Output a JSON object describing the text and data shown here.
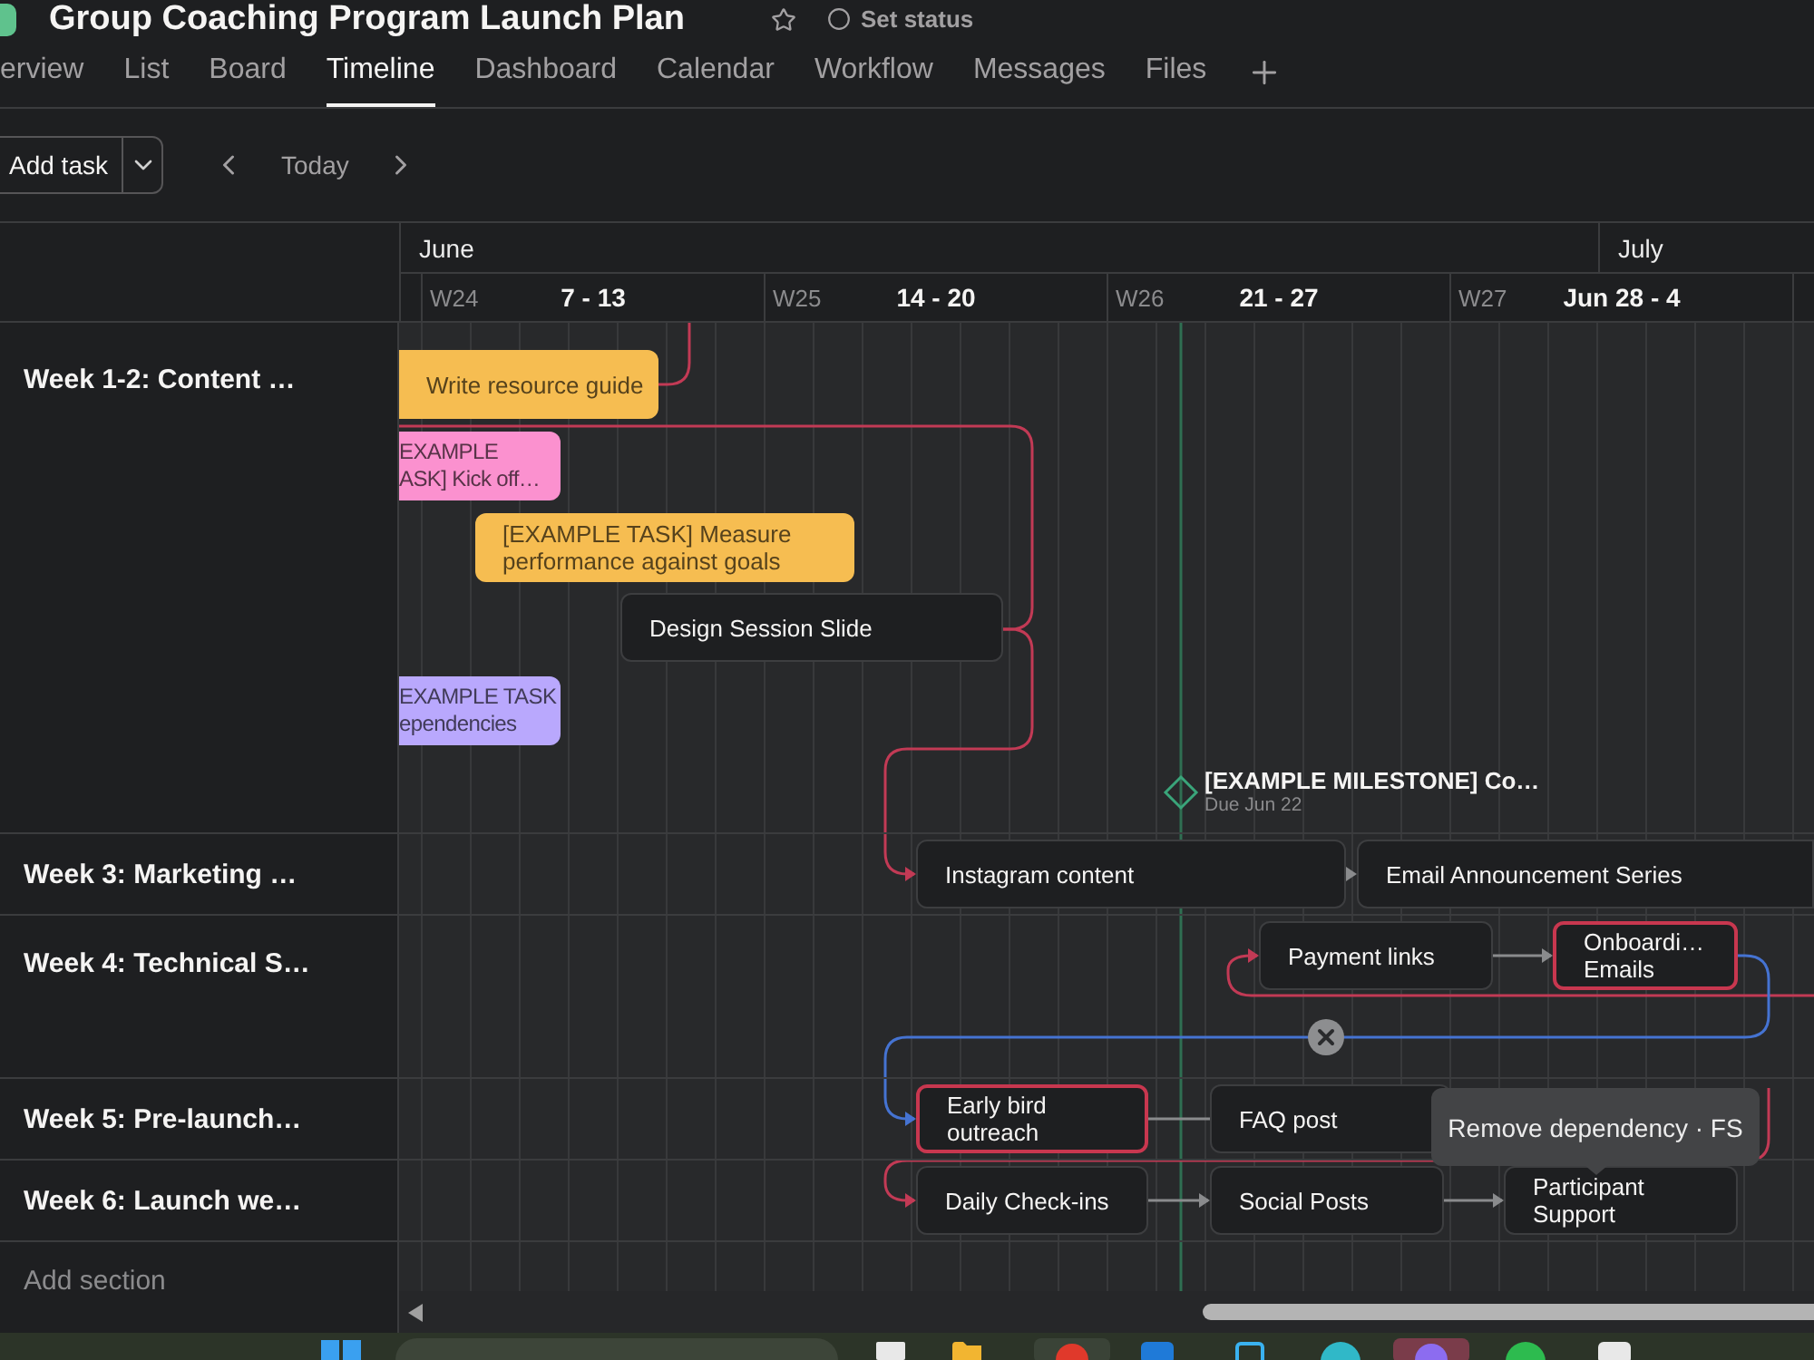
{
  "project": {
    "title": "Group Coaching Program Launch Plan",
    "status": "Set status"
  },
  "tabs": [
    {
      "label": "erview",
      "selected": false
    },
    {
      "label": "List",
      "selected": false
    },
    {
      "label": "Board",
      "selected": false
    },
    {
      "label": "Timeline",
      "selected": true
    },
    {
      "label": "Dashboard",
      "selected": false
    },
    {
      "label": "Calendar",
      "selected": false
    },
    {
      "label": "Workflow",
      "selected": false
    },
    {
      "label": "Messages",
      "selected": false
    },
    {
      "label": "Files",
      "selected": false
    }
  ],
  "toolbar": {
    "add_task": "Add task",
    "today": "Today"
  },
  "timeline": {
    "months": [
      "June",
      "July"
    ],
    "weeks": [
      {
        "number": "W24",
        "range": "7 - 13"
      },
      {
        "number": "W25",
        "range": "14 - 20"
      },
      {
        "number": "W26",
        "range": "21 - 27"
      },
      {
        "number": "W27",
        "range": "Jun 28 - 4"
      }
    ]
  },
  "sections": [
    {
      "name": "Week 1-2: Content …",
      "tasks": [
        {
          "name": "Write resource guide",
          "color": "#f6bd51",
          "highlighted": false
        },
        {
          "name": "EXAMPLE\nASK] Kick off…",
          "color": "#fb91cf",
          "highlighted": false
        },
        {
          "name": "[EXAMPLE TASK] Measure performance against goals",
          "color": "#f6bd51",
          "highlighted": false
        },
        {
          "name": "Design Session Slide",
          "color": "#1e1f21",
          "highlighted": false
        },
        {
          "name": "EXAMPLE TASK\nependencies",
          "color": "#b9a8fd",
          "highlighted": false
        }
      ],
      "milestones": [
        {
          "name": "[EXAMPLE MILESTONE] Co…",
          "due": "Due Jun 22"
        }
      ]
    },
    {
      "name": "Week 3: Marketing …",
      "tasks": [
        {
          "name": "Instagram content",
          "color": "#1e1f21",
          "highlighted": false
        },
        {
          "name": "Email Announcement Series",
          "color": "#1e1f21",
          "highlighted": false
        }
      ]
    },
    {
      "name": "Week 4: Technical S…",
      "tasks": [
        {
          "name": "Payment links",
          "color": "#1e1f21",
          "highlighted": false
        },
        {
          "name": "Onboardi… Emails",
          "color": "#1e1f21",
          "highlighted": true
        }
      ]
    },
    {
      "name": "Week 5: Pre-launch…",
      "tasks": [
        {
          "name": "Early bird outreach",
          "color": "#1e1f21",
          "highlighted": true
        },
        {
          "name": "FAQ post",
          "color": "#1e1f21",
          "highlighted": false
        }
      ]
    },
    {
      "name": "Week 6: Launch we…",
      "tasks": [
        {
          "name": "Daily Check-ins",
          "color": "#1e1f21",
          "highlighted": false
        },
        {
          "name": "Social Posts",
          "color": "#1e1f21",
          "highlighted": false
        },
        {
          "name": "Participant Support",
          "color": "#1e1f21",
          "highlighted": false
        }
      ]
    }
  ],
  "add_section": "Add section",
  "tooltip": "Remove dependency · FS"
}
